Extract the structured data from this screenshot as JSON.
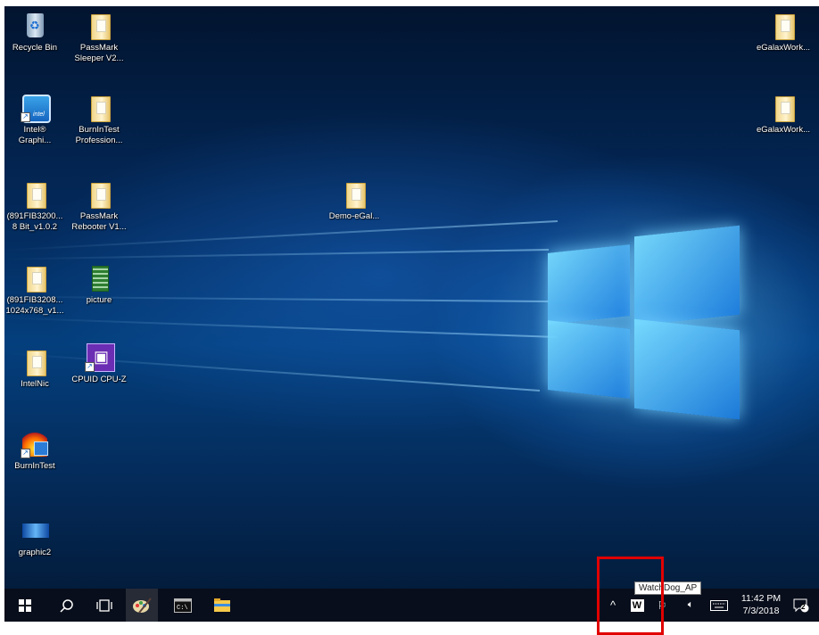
{
  "desktop": {
    "icons": [
      {
        "name": "recycle-bin-icon",
        "label": "Recycle Bin"
      },
      {
        "name": "passmark-sleeper-icon",
        "label": "PassMark\nSleeper V2..."
      },
      {
        "name": "intel-graphics-icon",
        "label": "Intel®\nGraphi..."
      },
      {
        "name": "burnintest-professional-icon",
        "label": "BurnInTest\nProfession..."
      },
      {
        "name": "folder-891fib3200-icon",
        "label": "(891FIB3200...\n8 Bit_v1.0.2"
      },
      {
        "name": "passmark-rebooter-icon",
        "label": "PassMark\nRebooter V1..."
      },
      {
        "name": "folder-891fib3208-icon",
        "label": "(891FIB3208...\n1024x768_v1..."
      },
      {
        "name": "picture-icon",
        "label": "picture"
      },
      {
        "name": "intelnic-icon",
        "label": "IntelNic"
      },
      {
        "name": "cpuid-cpuz-icon",
        "label": "CPUID CPU-Z"
      },
      {
        "name": "burnintest-icon",
        "label": "BurnInTest"
      },
      {
        "name": "graphic2-icon",
        "label": "graphic2"
      },
      {
        "name": "demo-egalax-icon",
        "label": "Demo-eGal..."
      },
      {
        "name": "egalaxwork-1-icon",
        "label": "eGalaxWork..."
      },
      {
        "name": "egalaxwork-2-icon",
        "label": "eGalaxWork..."
      }
    ]
  },
  "taskbar": {
    "start_icon": "windows-start-icon",
    "search_icon": "search-icon",
    "taskview_icon": "task-view-icon",
    "pinned": [
      "paint-brush-app-icon",
      "command-prompt-icon",
      "file-explorer-icon"
    ],
    "tray": {
      "chevron": "^",
      "watchdog_letter": "W",
      "tooltip": "WatchDog_AP",
      "time": "11:42 PM",
      "date": "7/3/2018",
      "notification_count": "2"
    }
  },
  "colors": {
    "highlight": "#e10000",
    "taskbar": "#080e1a",
    "wallpaper_glow": "#6ec8ff"
  }
}
